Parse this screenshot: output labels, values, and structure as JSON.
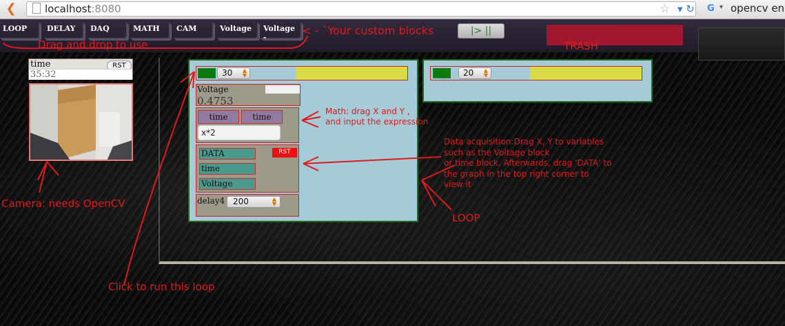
{
  "browser": {
    "url_host": "localhost",
    "url_port": ":8080",
    "search_text": "opencv enco",
    "back_icon": "back-arrow-icon",
    "star_icon": "star-icon",
    "reload_icon": "reload-icon"
  },
  "toolbar": {
    "blocks": [
      {
        "label": "LOOP",
        "color": "#1f1a2a"
      },
      {
        "label": "DELAY",
        "color": "#1f1a2a"
      },
      {
        "label": "DAQ",
        "color": "#1f1a2a"
      },
      {
        "label": "MATH",
        "color": "#1f1a2a"
      },
      {
        "label": "CAM",
        "color": "#1f1a2a"
      },
      {
        "label": "Voltage",
        "color": "#1f1a2a"
      },
      {
        "label": "Voltage -",
        "color": "#1f1a2a"
      }
    ],
    "run_label": "|> ||",
    "trash_label": "TRASH"
  },
  "time_widget": {
    "label": "time",
    "value": "35:32",
    "reset_label": "RST"
  },
  "loop1": {
    "count": "30",
    "voltage": {
      "label": "Voltage",
      "value": "0.4753"
    },
    "math": {
      "x": "time",
      "y": "time",
      "expression": "x*2"
    },
    "daq": {
      "items": [
        "DATA",
        "time",
        "Voltage"
      ],
      "reset_label": "RST"
    },
    "delay": {
      "label": "delay4",
      "value": "200"
    }
  },
  "loop2": {
    "count": "20"
  },
  "annotations": {
    "custom_blocks": "< - `Your custom blocks",
    "drag_drop": "Drag and drop to use",
    "math": "Math: drag X and Y ,\nand input the expression",
    "daq": "Data acquisition:Drag X, Y to variables\nsuch as the Voltage block\nor time block. Afterwards, drag 'DATA' to\nthe graph in the top right corner to\nview it",
    "camera": "Camera: needs OpenCV",
    "loop": "LOOP",
    "run": "Click to run this loop"
  },
  "colors": {
    "accent_red": "#e01a1a",
    "loop_bg": "#a5cad8",
    "loop_border": "#1f6e1f"
  }
}
